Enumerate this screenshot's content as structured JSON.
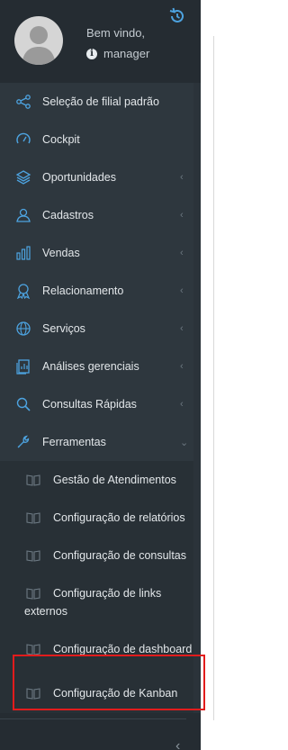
{
  "header": {
    "welcome": "Bem vindo,",
    "username": "manager"
  },
  "menu": [
    {
      "name": "selecao-filial",
      "icon": "share-icon",
      "label": "Seleção de filial padrão",
      "chevron": ""
    },
    {
      "name": "cockpit",
      "icon": "gauge-icon",
      "label": "Cockpit",
      "chevron": ""
    },
    {
      "name": "oportunidades",
      "icon": "layers-icon",
      "label": "Oportunidades",
      "chevron": "‹"
    },
    {
      "name": "cadastros",
      "icon": "user-icon",
      "label": "Cadastros",
      "chevron": "‹"
    },
    {
      "name": "vendas",
      "icon": "bar-chart-icon",
      "label": "Vendas",
      "chevron": "‹"
    },
    {
      "name": "relacionamento",
      "icon": "award-icon",
      "label": "Relacionamento",
      "chevron": "‹"
    },
    {
      "name": "servicos",
      "icon": "globe-icon",
      "label": "Serviços",
      "chevron": "‹"
    },
    {
      "name": "analises",
      "icon": "report-icon",
      "label": "Análises gerenciais",
      "chevron": "‹"
    },
    {
      "name": "consultas",
      "icon": "search-icon",
      "label": "Consultas Rápidas",
      "chevron": "‹"
    },
    {
      "name": "ferramentas",
      "icon": "wrench-icon",
      "label": "Ferramentas",
      "chevron": "⌄"
    }
  ],
  "submenu": [
    {
      "label": "Gestão de Atendimentos"
    },
    {
      "label": "Configuração de relatórios"
    },
    {
      "label": "Configuração de consultas"
    },
    {
      "label_line1": "Configuração de links",
      "label_line2": "externos"
    },
    {
      "label": "Configuração de dashboard"
    },
    {
      "label": "Configuração de Kanban"
    }
  ],
  "colors": {
    "sidebar_bg": "#2b333a",
    "text": "#e3e7ea",
    "icon_blue": "#4da3e0",
    "highlight": "#e21c1c"
  }
}
